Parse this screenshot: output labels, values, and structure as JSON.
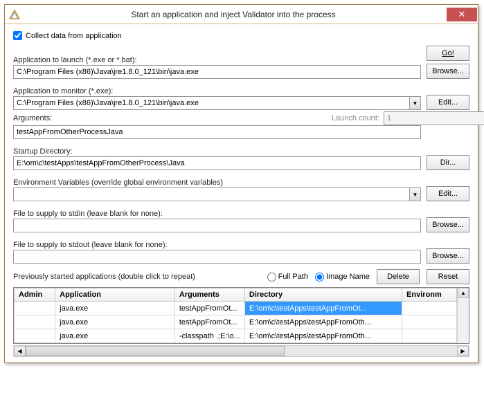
{
  "window": {
    "title": "Start an application and inject Validator into the process"
  },
  "collect": {
    "label": "Collect data from application",
    "checked": true
  },
  "appLaunch": {
    "label": "Application to launch (*.exe or *.bat):",
    "value": "C:\\Program Files (x86)\\Java\\jre1.8.0_121\\bin\\java.exe"
  },
  "appMonitor": {
    "label": "Application to monitor (*.exe):",
    "value": "C:\\Program Files (x86)\\Java\\jre1.8.0_121\\bin\\java.exe"
  },
  "arguments": {
    "label": "Arguments:",
    "value": "testAppFromOtherProcessJava",
    "launchCountLabel": "Launch count:",
    "launchCountValue": "1"
  },
  "startupDir": {
    "label": "Startup Directory:",
    "value": "E:\\om\\c\\testApps\\testAppFromOtherProcess\\Java"
  },
  "envVars": {
    "label": "Environment Variables (override global environment variables)",
    "value": ""
  },
  "stdin": {
    "label": "File to supply to stdin (leave blank for none):",
    "value": ""
  },
  "stdout": {
    "label": "File to supply to stdout (leave blank for none):",
    "value": ""
  },
  "buttons": {
    "go": "Go!",
    "browse": "Browse...",
    "edit": "Edit...",
    "dir": "Dir...",
    "delete": "Delete",
    "reset": "Reset"
  },
  "prev": {
    "label": "Previously started applications (double click to repeat)",
    "radioFull": "Full Path",
    "radioImage": "Image Name",
    "radioSel": "image",
    "headers": {
      "admin": "Admin",
      "app": "Application",
      "args": "Arguments",
      "dir": "Directory",
      "env": "Environm"
    },
    "rows": [
      {
        "admin": "",
        "app": "java.exe",
        "args": "testAppFromOt...",
        "dir": "E:\\om\\c\\testApps\\testAppFromOt...",
        "env": "",
        "sel": true
      },
      {
        "admin": "",
        "app": "java.exe",
        "args": "testAppFromOt...",
        "dir": "E:\\om\\c\\testApps\\testAppFromOth...",
        "env": ""
      },
      {
        "admin": "",
        "app": "java.exe",
        "args": "-classpath .;E:\\o...",
        "dir": "E:\\om\\c\\testApps\\testAppFromOth...",
        "env": ""
      }
    ]
  }
}
